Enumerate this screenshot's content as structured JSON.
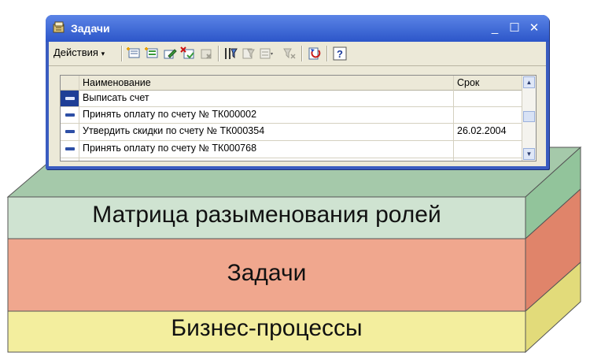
{
  "layers": {
    "roles": "Матрица разыменования ролей",
    "tasks": "Задачи",
    "processes": "Бизнес-процессы"
  },
  "window": {
    "title": "Задачи",
    "icon": "document-folder-icon",
    "controls": {
      "minimize": "_",
      "maximize": "☐",
      "close": "✕"
    }
  },
  "toolbar": {
    "actions_label": "Действия",
    "tools": [
      "add-icon",
      "add-group-icon",
      "edit-icon",
      "delete-mark-icon",
      "delete-icon",
      "filter-icon",
      "filter-settings-icon",
      "sort-icon",
      "clear-filter-icon",
      "refresh-icon",
      "help-icon"
    ]
  },
  "grid": {
    "columns": [
      "Наименование",
      "Срок"
    ],
    "rows": [
      {
        "name": "Выписать счет",
        "due": ""
      },
      {
        "name": "Принять оплату по счету № ТК000002",
        "due": ""
      },
      {
        "name": "Утвердить скидки по счету № ТК000354",
        "due": "26.02.2004"
      },
      {
        "name": "Принять оплату по счету № ТК000768",
        "due": ""
      }
    ]
  },
  "colors": {
    "roles_layer": "#cfe3d1",
    "tasks_layer": "#f0a78e",
    "processes_layer": "#f3ee9e",
    "title_bar": "#2c56c9"
  }
}
